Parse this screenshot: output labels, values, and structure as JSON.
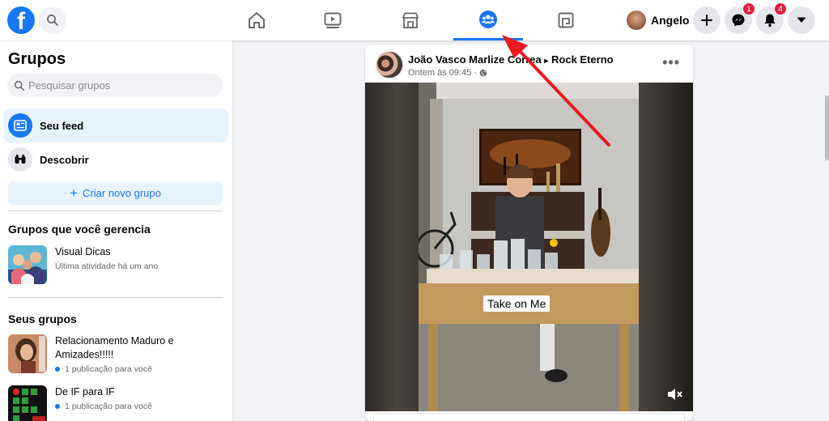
{
  "topbar": {
    "logo_letter": "f",
    "profile_name": "Angelo",
    "messenger_badge": "1",
    "notifications_badge": "4",
    "nav": [
      "home-icon",
      "watch-icon",
      "marketplace-icon",
      "groups-icon",
      "gaming-icon"
    ],
    "active_nav": "groups-icon",
    "accent": "#1877f2"
  },
  "sidebar": {
    "title": "Grupos",
    "search_placeholder": "Pesquisar grupos",
    "items": [
      {
        "label": "Seu feed",
        "icon": "feed-icon",
        "active": true
      },
      {
        "label": "Descobrir",
        "icon": "discover-icon",
        "active": false
      }
    ],
    "create_label": "Criar novo grupo",
    "managed_heading": "Grupos que você gerencia",
    "managed_groups": [
      {
        "name": "Visual Dicas",
        "sub": "Última atividade há um ano"
      }
    ],
    "your_groups_heading": "Seus grupos",
    "your_groups": [
      {
        "name": "Relacionamento Maduro e Amizades!!!!!",
        "sub": "1 publicação para você"
      },
      {
        "name": "De IF para IF",
        "sub": "1 publicação para você"
      }
    ]
  },
  "post": {
    "title": "João Vasco Marlize Correa ▸ Rock Eterno",
    "title_main": "João Vasco Marlize Correa",
    "title_group": "Rock Eterno",
    "time": "Ontem às 09:45",
    "privacy_icon": "globe-icon",
    "more_icon": "more-icon",
    "video_caption": "Take on Me",
    "mute_icon": "muted-speaker-icon"
  },
  "annotation": {
    "arrow_color": "#e8191f"
  }
}
